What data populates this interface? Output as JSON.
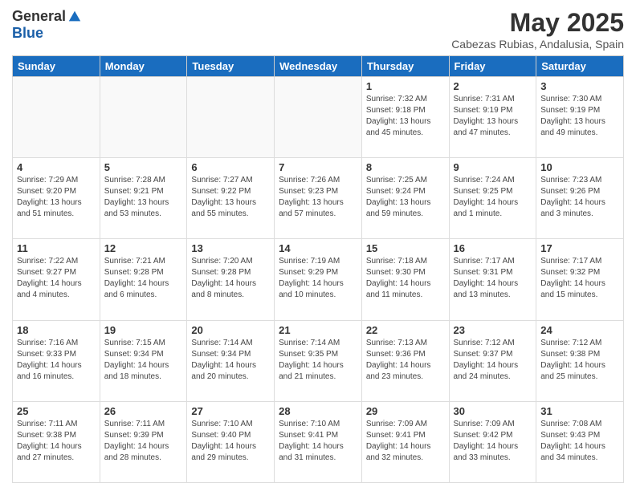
{
  "logo": {
    "general": "General",
    "blue": "Blue"
  },
  "title": "May 2025",
  "subtitle": "Cabezas Rubias, Andalusia, Spain",
  "days_header": [
    "Sunday",
    "Monday",
    "Tuesday",
    "Wednesday",
    "Thursday",
    "Friday",
    "Saturday"
  ],
  "weeks": [
    [
      {
        "num": "",
        "info": ""
      },
      {
        "num": "",
        "info": ""
      },
      {
        "num": "",
        "info": ""
      },
      {
        "num": "",
        "info": ""
      },
      {
        "num": "1",
        "info": "Sunrise: 7:32 AM\nSunset: 9:18 PM\nDaylight: 13 hours\nand 45 minutes."
      },
      {
        "num": "2",
        "info": "Sunrise: 7:31 AM\nSunset: 9:19 PM\nDaylight: 13 hours\nand 47 minutes."
      },
      {
        "num": "3",
        "info": "Sunrise: 7:30 AM\nSunset: 9:19 PM\nDaylight: 13 hours\nand 49 minutes."
      }
    ],
    [
      {
        "num": "4",
        "info": "Sunrise: 7:29 AM\nSunset: 9:20 PM\nDaylight: 13 hours\nand 51 minutes."
      },
      {
        "num": "5",
        "info": "Sunrise: 7:28 AM\nSunset: 9:21 PM\nDaylight: 13 hours\nand 53 minutes."
      },
      {
        "num": "6",
        "info": "Sunrise: 7:27 AM\nSunset: 9:22 PM\nDaylight: 13 hours\nand 55 minutes."
      },
      {
        "num": "7",
        "info": "Sunrise: 7:26 AM\nSunset: 9:23 PM\nDaylight: 13 hours\nand 57 minutes."
      },
      {
        "num": "8",
        "info": "Sunrise: 7:25 AM\nSunset: 9:24 PM\nDaylight: 13 hours\nand 59 minutes."
      },
      {
        "num": "9",
        "info": "Sunrise: 7:24 AM\nSunset: 9:25 PM\nDaylight: 14 hours\nand 1 minute."
      },
      {
        "num": "10",
        "info": "Sunrise: 7:23 AM\nSunset: 9:26 PM\nDaylight: 14 hours\nand 3 minutes."
      }
    ],
    [
      {
        "num": "11",
        "info": "Sunrise: 7:22 AM\nSunset: 9:27 PM\nDaylight: 14 hours\nand 4 minutes."
      },
      {
        "num": "12",
        "info": "Sunrise: 7:21 AM\nSunset: 9:28 PM\nDaylight: 14 hours\nand 6 minutes."
      },
      {
        "num": "13",
        "info": "Sunrise: 7:20 AM\nSunset: 9:28 PM\nDaylight: 14 hours\nand 8 minutes."
      },
      {
        "num": "14",
        "info": "Sunrise: 7:19 AM\nSunset: 9:29 PM\nDaylight: 14 hours\nand 10 minutes."
      },
      {
        "num": "15",
        "info": "Sunrise: 7:18 AM\nSunset: 9:30 PM\nDaylight: 14 hours\nand 11 minutes."
      },
      {
        "num": "16",
        "info": "Sunrise: 7:17 AM\nSunset: 9:31 PM\nDaylight: 14 hours\nand 13 minutes."
      },
      {
        "num": "17",
        "info": "Sunrise: 7:17 AM\nSunset: 9:32 PM\nDaylight: 14 hours\nand 15 minutes."
      }
    ],
    [
      {
        "num": "18",
        "info": "Sunrise: 7:16 AM\nSunset: 9:33 PM\nDaylight: 14 hours\nand 16 minutes."
      },
      {
        "num": "19",
        "info": "Sunrise: 7:15 AM\nSunset: 9:34 PM\nDaylight: 14 hours\nand 18 minutes."
      },
      {
        "num": "20",
        "info": "Sunrise: 7:14 AM\nSunset: 9:34 PM\nDaylight: 14 hours\nand 20 minutes."
      },
      {
        "num": "21",
        "info": "Sunrise: 7:14 AM\nSunset: 9:35 PM\nDaylight: 14 hours\nand 21 minutes."
      },
      {
        "num": "22",
        "info": "Sunrise: 7:13 AM\nSunset: 9:36 PM\nDaylight: 14 hours\nand 23 minutes."
      },
      {
        "num": "23",
        "info": "Sunrise: 7:12 AM\nSunset: 9:37 PM\nDaylight: 14 hours\nand 24 minutes."
      },
      {
        "num": "24",
        "info": "Sunrise: 7:12 AM\nSunset: 9:38 PM\nDaylight: 14 hours\nand 25 minutes."
      }
    ],
    [
      {
        "num": "25",
        "info": "Sunrise: 7:11 AM\nSunset: 9:38 PM\nDaylight: 14 hours\nand 27 minutes."
      },
      {
        "num": "26",
        "info": "Sunrise: 7:11 AM\nSunset: 9:39 PM\nDaylight: 14 hours\nand 28 minutes."
      },
      {
        "num": "27",
        "info": "Sunrise: 7:10 AM\nSunset: 9:40 PM\nDaylight: 14 hours\nand 29 minutes."
      },
      {
        "num": "28",
        "info": "Sunrise: 7:10 AM\nSunset: 9:41 PM\nDaylight: 14 hours\nand 31 minutes."
      },
      {
        "num": "29",
        "info": "Sunrise: 7:09 AM\nSunset: 9:41 PM\nDaylight: 14 hours\nand 32 minutes."
      },
      {
        "num": "30",
        "info": "Sunrise: 7:09 AM\nSunset: 9:42 PM\nDaylight: 14 hours\nand 33 minutes."
      },
      {
        "num": "31",
        "info": "Sunrise: 7:08 AM\nSunset: 9:43 PM\nDaylight: 14 hours\nand 34 minutes."
      }
    ]
  ]
}
